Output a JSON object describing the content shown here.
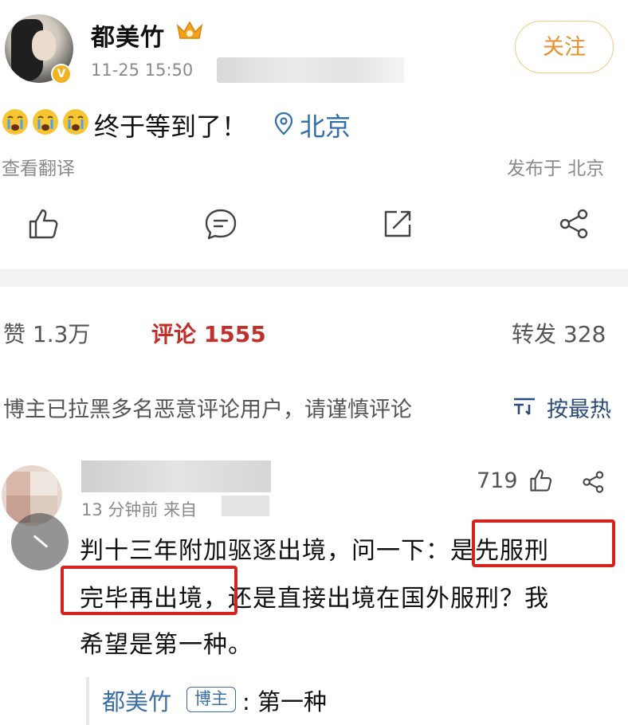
{
  "post": {
    "author": "都美竹",
    "time": "11-25 15:50",
    "follow_label": "关注",
    "text": "终于等到了！",
    "location": "北京",
    "translate_label": "查看翻译",
    "published_label": "发布于 北京",
    "emoji_icons": [
      "crying-face-icon",
      "crying-face-icon",
      "crying-face-icon"
    ],
    "actions": [
      "like-icon",
      "comment-icon",
      "repost-icon",
      "share-icon"
    ]
  },
  "stats": {
    "likes": "赞 1.3万",
    "comments": "评论 1555",
    "reposts": "转发 328"
  },
  "comments_header": {
    "notice": "博主已拉黑多名恶意评论用户，请谨慎评论",
    "sort_label": "按最热",
    "sort_icon": "sort-icon"
  },
  "comment": {
    "time": "13 分钟前  来自",
    "likes": "719",
    "lines": [
      "判十三年附加驱逐出境，问一下：是先服刑",
      "完毕再出境，还是直接出境在国外服刑？我",
      "希望是第一种。"
    ],
    "reply": {
      "author": "都美竹",
      "tag": "博主",
      "text": ": 第一种"
    }
  },
  "colors": {
    "accent_orange": "#e8902b",
    "link_blue": "#2f6ea8",
    "comment_red": "#c0302b",
    "highlight_box": "#d6211d"
  }
}
